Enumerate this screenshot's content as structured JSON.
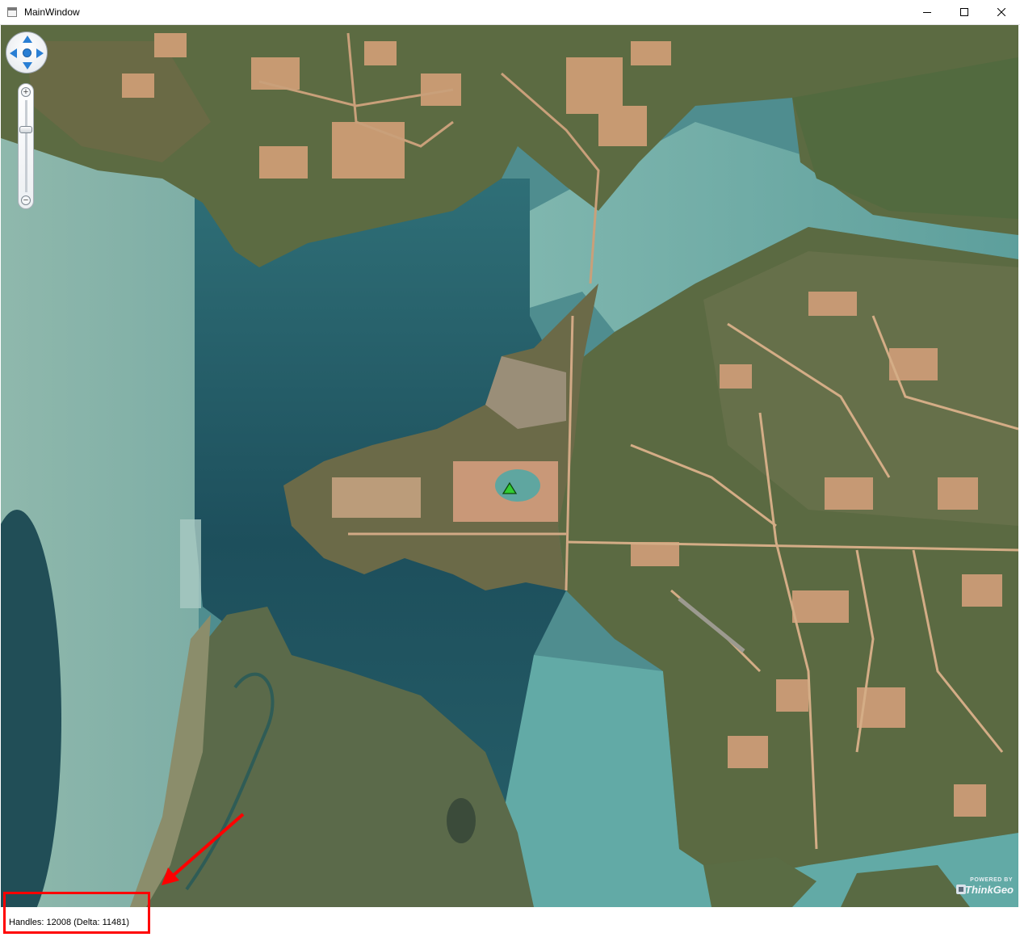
{
  "window": {
    "title": "MainWindow",
    "controls": [
      "minimize-icon",
      "maximize-icon",
      "close-icon"
    ]
  },
  "map": {
    "pan_control": [
      "pan-up-icon",
      "pan-down-icon",
      "pan-left-icon",
      "pan-right-icon",
      "pan-center-icon"
    ],
    "zoom": {
      "plus_label": "+",
      "minus_label": "−",
      "level": 0.35
    },
    "logo": {
      "tagline": "POWERED BY",
      "brand": "ThinkGeo"
    },
    "marker_icon": "triangle-marker-icon",
    "colors": {
      "marker": "#32cd32",
      "annotation": "#ff0000"
    }
  },
  "status": {
    "text": "Handles: 12008 (Delta: 11481)"
  }
}
